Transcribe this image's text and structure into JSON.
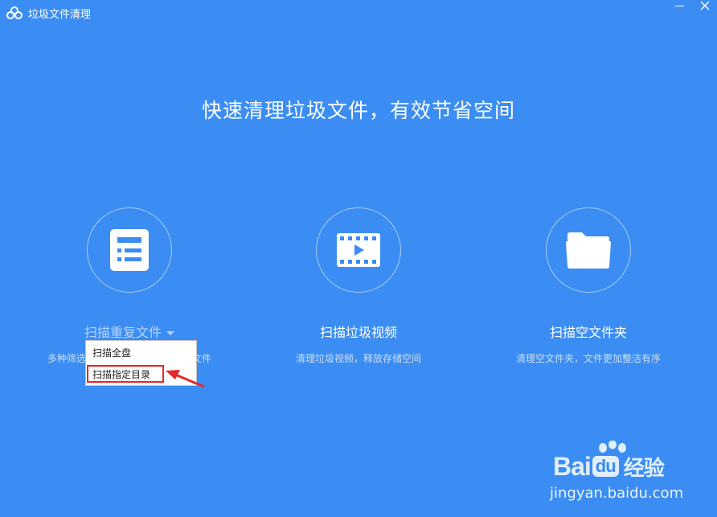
{
  "window": {
    "title": "垃圾文件清理",
    "minimize_icon": "minimize-icon",
    "close_icon": "close-icon"
  },
  "headline": "快速清理垃圾文件，有效节省空间",
  "features": [
    {
      "icon": "document-list-icon",
      "title": "扫描重复文件",
      "description": "多种筛选方式，快速找出重复文件",
      "visible_left": "多种筛选",
      "visible_right": "文件"
    },
    {
      "icon": "video-play-icon",
      "title": "扫描垃圾视频",
      "description": "清理垃圾视频，释放存储空间"
    },
    {
      "icon": "folder-icon",
      "title": "扫描空文件夹",
      "description": "清理空文件夹，文件更加整洁有序"
    }
  ],
  "dropdown": {
    "items": [
      "扫描全盘",
      "扫描指定目录"
    ],
    "highlighted_index": 1
  },
  "watermark": {
    "brand": "Bai",
    "brand_du": "du",
    "brand_cn": "经验",
    "url": "jingyan.baidu.com"
  },
  "colors": {
    "background": "#3b8df3",
    "highlight": "#e5282b"
  }
}
